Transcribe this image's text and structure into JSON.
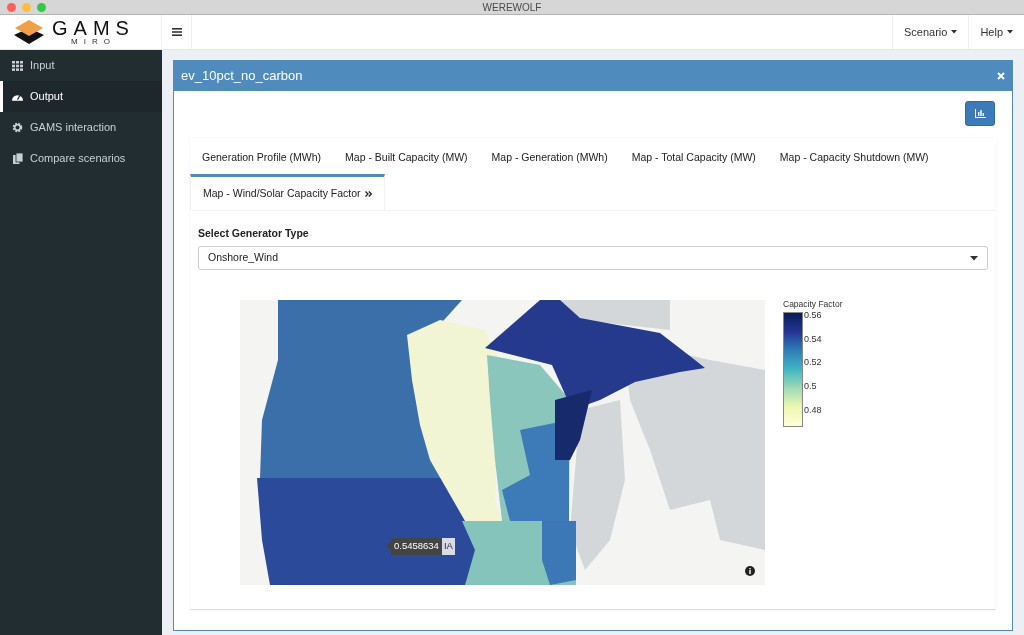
{
  "window": {
    "title": "WEREWOLF"
  },
  "header": {
    "logo": {
      "name": "GAMS",
      "subtitle": "MIRO"
    },
    "menus": [
      {
        "label": "Scenario"
      },
      {
        "label": "Help"
      }
    ]
  },
  "sidebar": {
    "items": [
      {
        "label": "Input",
        "selected": false
      },
      {
        "label": "Output",
        "selected": true
      },
      {
        "label": "GAMS interaction",
        "selected": false
      },
      {
        "label": "Compare scenarios",
        "selected": false
      }
    ]
  },
  "box": {
    "title": "ev_10pct_no_carbon",
    "tabs": [
      {
        "label": "Generation Profile (MWh)",
        "selected": false
      },
      {
        "label": "Map - Built Capacity (MW)",
        "selected": false
      },
      {
        "label": "Map - Generation (MWh)",
        "selected": false
      },
      {
        "label": "Map - Total Capacity (MW)",
        "selected": false
      },
      {
        "label": "Map - Capacity Shutdown (MW)",
        "selected": false
      },
      {
        "label": "Map - Wind/Solar Capacity Factor",
        "selected": true
      }
    ],
    "select": {
      "label": "Select Generator Type",
      "value": "Onshore_Wind"
    },
    "map": {
      "kind": "picture",
      "tooltip": {
        "value": "0.5458634",
        "region": "IA"
      },
      "colorbar": {
        "title": "Capacity Factor",
        "ticks": [
          "0.56",
          "0.54",
          "0.52",
          "0.5",
          "0.48"
        ]
      }
    }
  }
}
